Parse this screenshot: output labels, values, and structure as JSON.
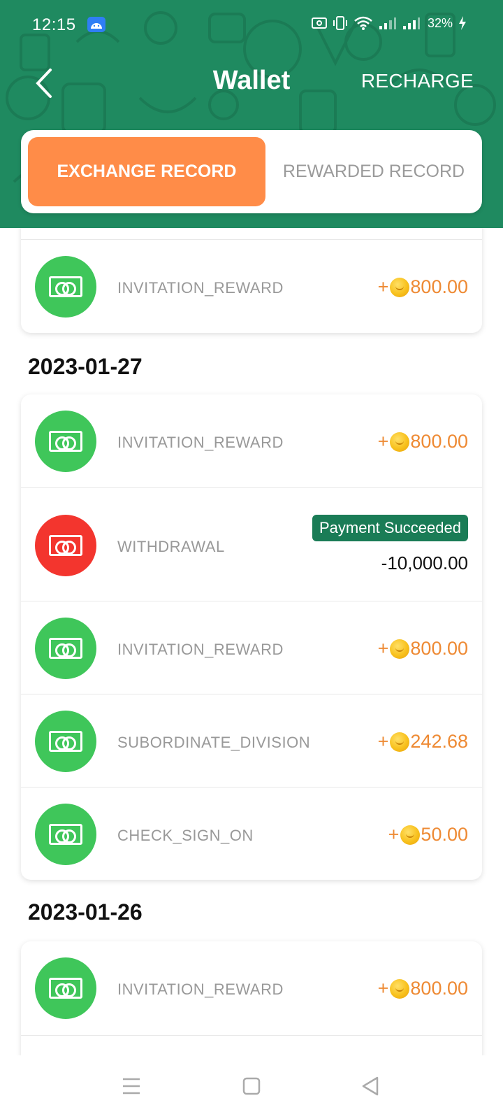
{
  "status_bar": {
    "time": "12:15",
    "battery": "32%"
  },
  "header": {
    "title": "Wallet",
    "recharge_label": "RECHARGE"
  },
  "tabs": [
    {
      "label": "EXCHANGE RECORD",
      "active": true
    },
    {
      "label": "REWARDED RECORD",
      "active": false
    }
  ],
  "colors": {
    "header_bg": "#1f8a60",
    "active_tab": "#ff8c48",
    "income_icon": "#3fc65a",
    "withdraw_icon": "#f3352e",
    "amount": "#ee8a34",
    "badge": "#1a7c56"
  },
  "groups": [
    {
      "date": "",
      "rows": [
        {
          "label": "INVITATION_REWARD",
          "sign": "+",
          "amount": "800.00",
          "type": "income"
        }
      ]
    },
    {
      "date": "2023-01-27",
      "rows": [
        {
          "label": "INVITATION_REWARD",
          "sign": "+",
          "amount": "800.00",
          "type": "income"
        },
        {
          "label": "WITHDRAWAL",
          "status": "Payment Succeeded",
          "amount": "-10,000.00",
          "type": "withdraw"
        },
        {
          "label": "INVITATION_REWARD",
          "sign": "+",
          "amount": "800.00",
          "type": "income"
        },
        {
          "label": "SUBORDINATE_DIVISION",
          "sign": "+",
          "amount": "242.68",
          "type": "income"
        },
        {
          "label": "CHECK_SIGN_ON",
          "sign": "+",
          "amount": "50.00",
          "type": "income"
        }
      ]
    },
    {
      "date": "2023-01-26",
      "rows": [
        {
          "label": "INVITATION_REWARD",
          "sign": "+",
          "amount": "800.00",
          "type": "income"
        }
      ]
    }
  ],
  "system_nav": {
    "icons": [
      "menu-icon",
      "home-icon",
      "back-icon"
    ]
  }
}
